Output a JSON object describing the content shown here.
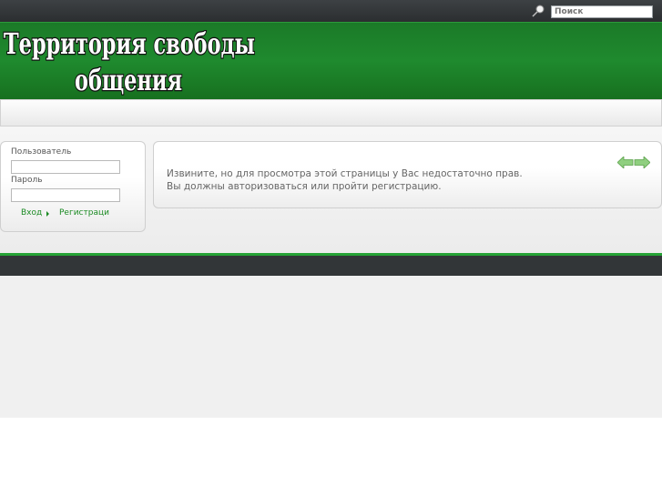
{
  "topbar": {
    "search_placeholder": "Поиск",
    "search_icon": "search-icon"
  },
  "header": {
    "logo_line1": "Территория свободы",
    "logo_line2": "общения"
  },
  "login": {
    "username_label": "Пользователь",
    "password_label": "Пароль",
    "login_link": "Вход",
    "register_link": "Регистраци"
  },
  "content": {
    "message_line1": "Извините, но для просмотра этой страницы у Вас недостаточно прав.",
    "message_line2": "Вы должны авторизоваться или пройти регистрацию.",
    "prev_icon": "arrow-left-icon",
    "next_icon": "arrow-right-icon"
  },
  "colors": {
    "header_green": "#1f8a2e",
    "link_green": "#1a8a22",
    "topbar_dark": "#2b2e30"
  }
}
